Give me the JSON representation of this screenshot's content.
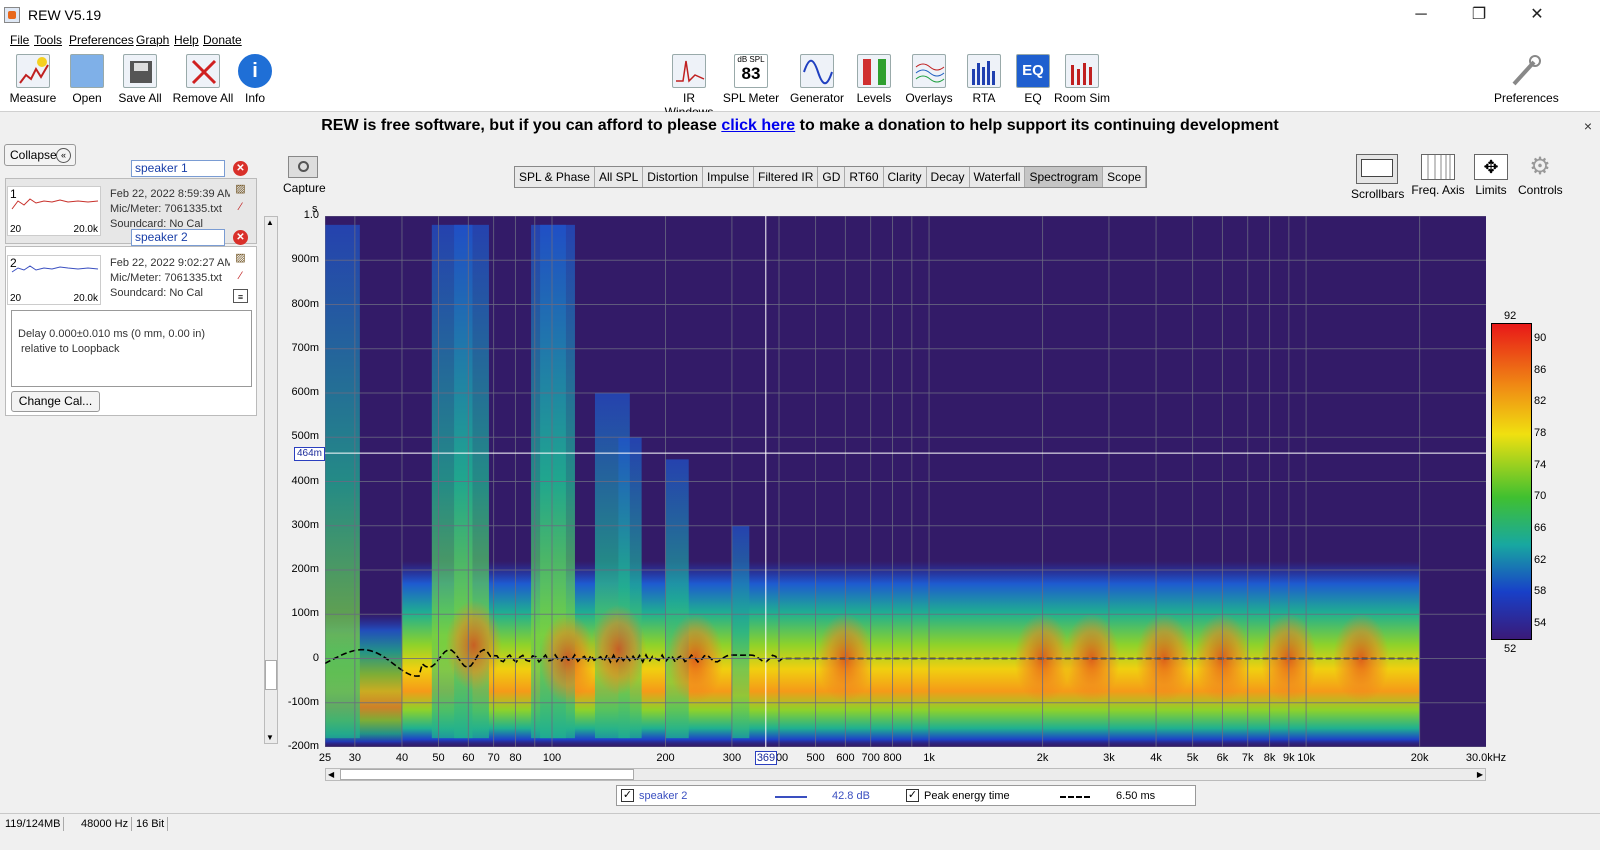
{
  "window": {
    "title": "REW V5.19",
    "minimize": "─",
    "maximize": "❐",
    "close": "✕"
  },
  "menu": [
    "File",
    "Tools",
    "Preferences",
    "Graph",
    "Help",
    "Donate"
  ],
  "toolbar": {
    "left": [
      "Measure",
      "Open",
      "Save All",
      "Remove All",
      "Info"
    ],
    "center": [
      "IR Windows",
      "SPL Meter",
      "Generator",
      "Levels",
      "Overlays",
      "RTA",
      "EQ",
      "Room Sim"
    ],
    "spl_meter_top": "dB SPL",
    "spl_meter_value": "83",
    "eq_icon_text": "EQ",
    "right": "Preferences"
  },
  "banner": {
    "before": "REW is free software, but if you can afford to please",
    "link": "click here",
    "after": "to make a donation to help support its continuing development",
    "close": "×"
  },
  "panel": {
    "collapse": "Collapse",
    "collapse_icon": "«",
    "measurements": [
      {
        "num": "1",
        "name": "speaker 1",
        "lo": "20",
        "hi": "20.0k",
        "date": "Feb 22, 2022 8:59:39 AM",
        "mic": "Mic/Meter: 7061335.txt",
        "soundcard": "Soundcard: No Cal",
        "color": "#c8302a"
      },
      {
        "num": "2",
        "name": "speaker 2",
        "lo": "20",
        "hi": "20.0k",
        "date": "Feb 22, 2022 9:02:27 AM",
        "mic": "Mic/Meter: 7061335.txt",
        "soundcard": "Soundcard: No Cal",
        "color": "#3a4fc0"
      }
    ],
    "delay_line1": "Delay 0.000±0.010 ms (0 mm, 0.00 in)",
    "delay_line2": "relative to Loopback",
    "change_cal": "Change Cal..."
  },
  "capture": "Capture",
  "tabs": [
    "SPL & Phase",
    "All SPL",
    "Distortion",
    "Impulse",
    "Filtered IR",
    "GD",
    "RT60",
    "Clarity",
    "Decay",
    "Waterfall",
    "Spectrogram",
    "Scope"
  ],
  "active_tab": "Spectrogram",
  "graph_controls": [
    "Scrollbars",
    "Freq. Axis",
    "Limits",
    "Controls"
  ],
  "graph": {
    "y_unit": "s",
    "y_labels": [
      "1.0",
      "900m",
      "800m",
      "700m",
      "600m",
      "500m",
      "400m",
      "300m",
      "200m",
      "100m",
      "0",
      "-100m",
      "-200m"
    ],
    "x_labels": [
      "25",
      "30",
      "40",
      "50",
      "60",
      "70",
      "80",
      "100",
      "200",
      "300",
      "400",
      "500",
      "600",
      "700",
      "800",
      "1k",
      "2k",
      "3k",
      "4k",
      "5k",
      "6k",
      "7k",
      "8k",
      "9k",
      "10k",
      "20k",
      "30.0kHz"
    ],
    "cursor_y": "464m",
    "cursor_x": "369",
    "colors": {
      "background": "#331b68",
      "grid": "#6a6a82",
      "cursor": "#ffffff",
      "peak_line": "#000000"
    }
  },
  "color_scale": {
    "top": "92",
    "bottom": "52",
    "ticks": [
      "90",
      "86",
      "82",
      "78",
      "74",
      "70",
      "66",
      "62",
      "58",
      "54"
    ]
  },
  "legend": {
    "series": "speaker 2",
    "series_value": "42.8 dB",
    "peak_label": "Peak energy time",
    "peak_value": "6.50 ms",
    "check": "✓"
  },
  "status": [
    "119/124MB",
    "48000 Hz",
    "16 Bit"
  ]
}
